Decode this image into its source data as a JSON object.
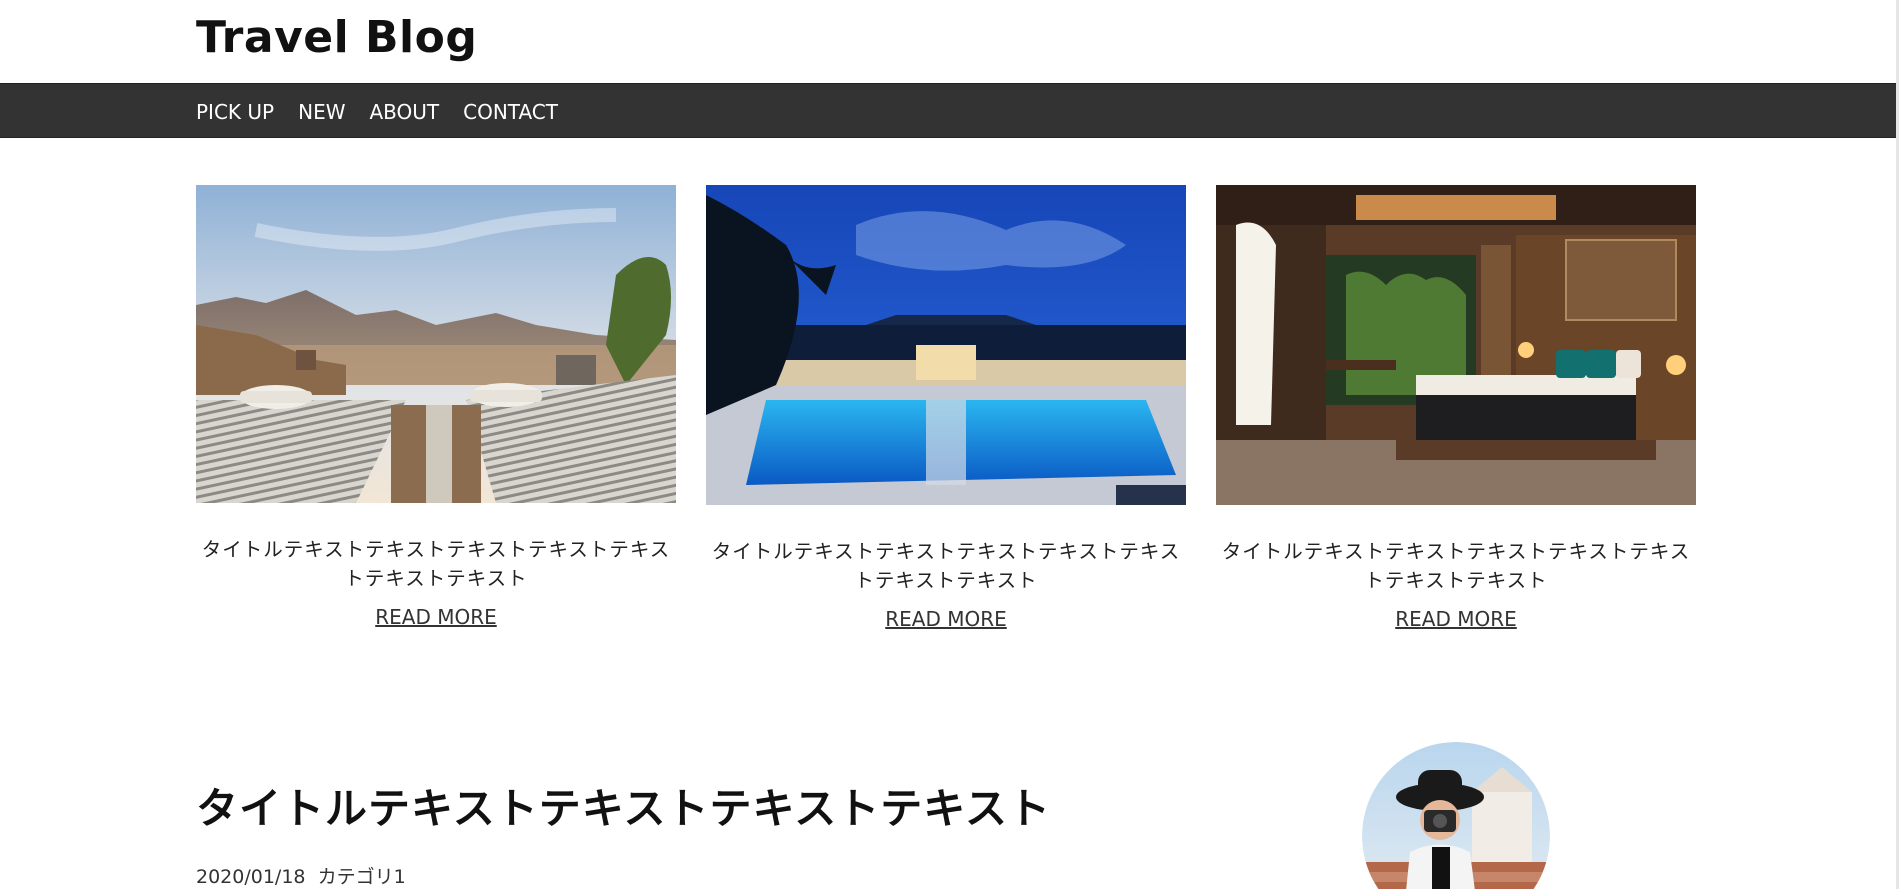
{
  "site": {
    "title": "Travel Blog"
  },
  "nav": {
    "items": [
      "PICK UP",
      "NEW",
      "ABOUT",
      "CONTACT"
    ]
  },
  "cards": [
    {
      "title": "タイトルテキストテキストテキストテキストテキストテキストテキスト",
      "more": "READ MORE",
      "image": "rooftop-loungers-mountains-photo"
    },
    {
      "title": "タイトルテキストテキストテキストテキストテキストテキストテキスト",
      "more": "READ MORE",
      "image": "resort-pool-at-dusk-photo"
    },
    {
      "title": "タイトルテキストテキストテキストテキストテキストテキストテキスト",
      "more": "READ MORE",
      "image": "hotel-bedroom-photo"
    }
  ],
  "post": {
    "title": "タイトルテキストテキストテキストテキスト",
    "date": "2020/01/18",
    "category": "カテゴリ1"
  },
  "profile": {
    "image": "woman-with-camera-photo"
  },
  "colors": {
    "navbar_bg": "#333333",
    "nav_text": "#ffffff",
    "title_text": "#111111"
  }
}
